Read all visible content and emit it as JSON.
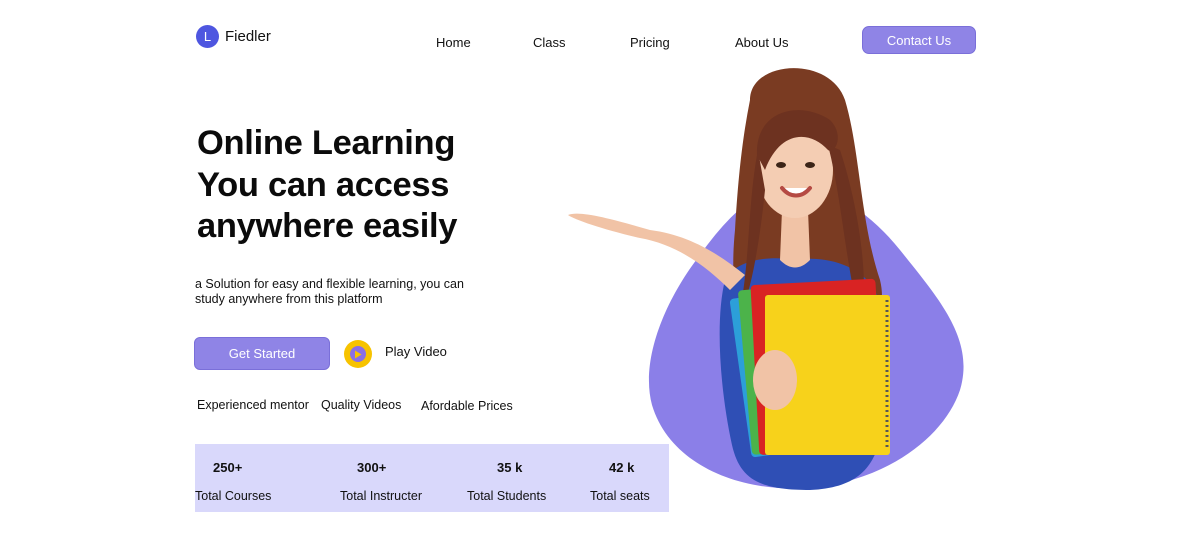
{
  "brand": {
    "initial": "L",
    "name": "Fiedler"
  },
  "nav": {
    "items": [
      {
        "label": "Home"
      },
      {
        "label": "Class"
      },
      {
        "label": "Pricing"
      },
      {
        "label": "About Us"
      }
    ],
    "cta_label": "Contact Us"
  },
  "hero": {
    "title_lines": [
      "Online Learning",
      "You can access",
      "anywhere easily"
    ],
    "subtitle": "a Solution for easy and flexible learning, you can study anywhere from this platform",
    "primary_button": "Get Started",
    "video_button": "Play Video"
  },
  "features": [
    "Experienced mentor",
    "Quality Videos",
    "Afordable Prices"
  ],
  "stats": [
    {
      "value": "250+",
      "label": "Total Courses"
    },
    {
      "value": "300+",
      "label": "Total Instructer"
    },
    {
      "value": "35 k",
      "label": "Total Students"
    },
    {
      "value": "42 k",
      "label": "Total seats"
    }
  ],
  "colors": {
    "accent": "#8f84e6",
    "blob": "#8b7fe8",
    "stats_bg": "#d9d8fb",
    "logo": "#4e56e0",
    "play": "#f7c300"
  },
  "image": {
    "subject": "woman holding colorful notebooks"
  }
}
